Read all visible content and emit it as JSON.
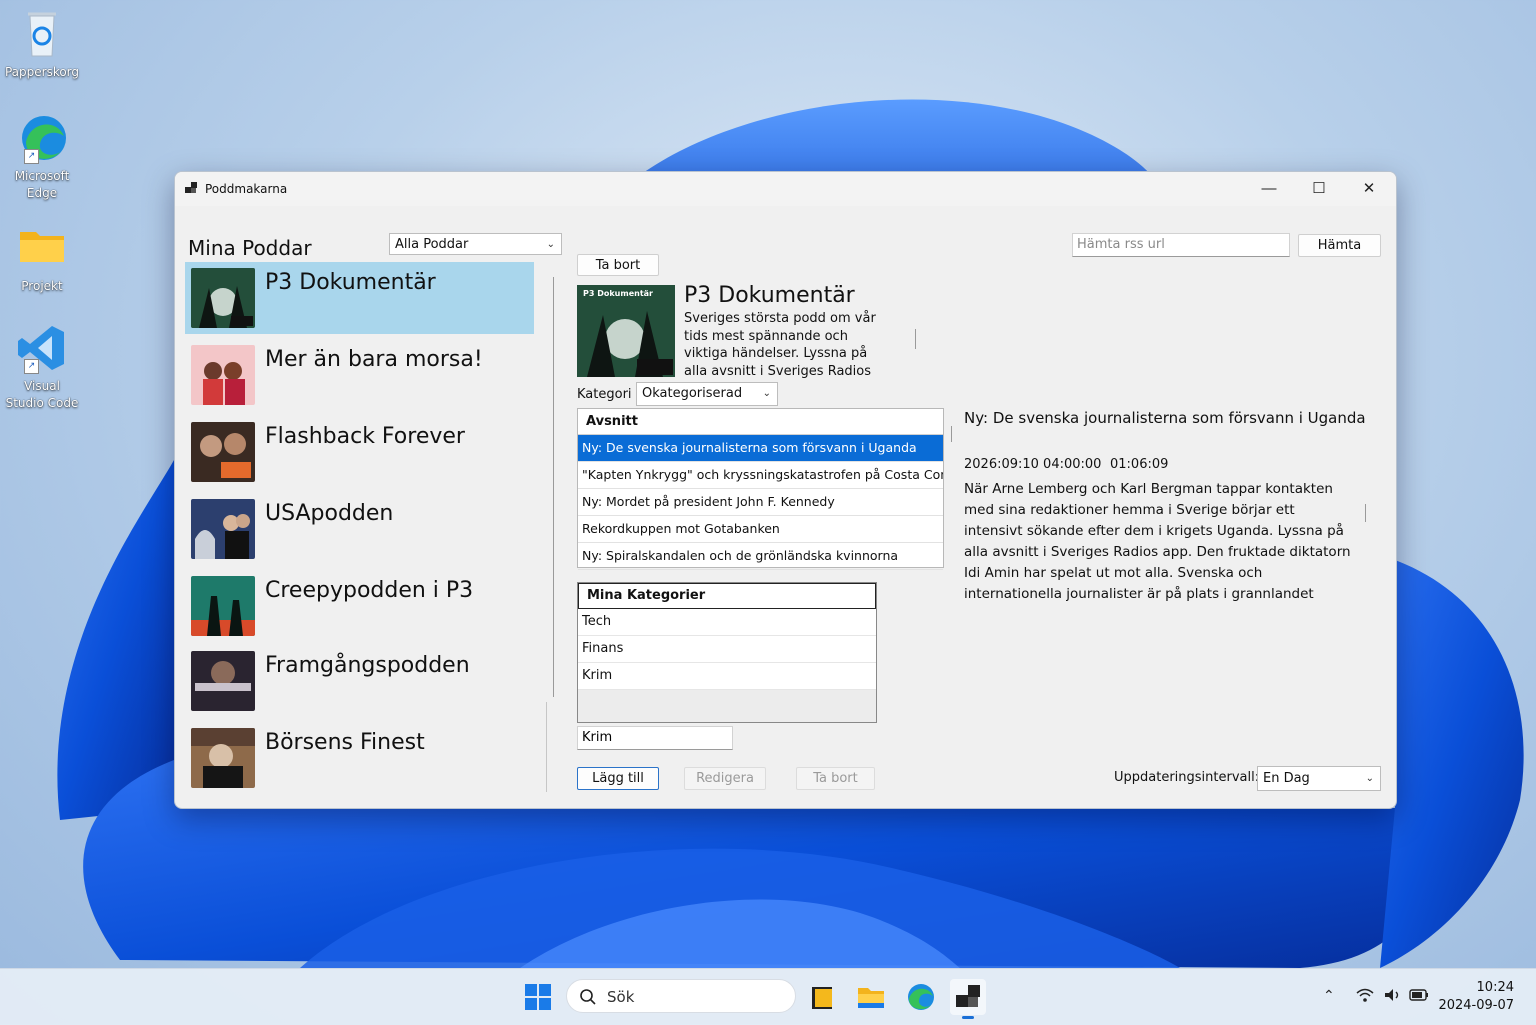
{
  "desktop": {
    "icons": [
      {
        "label": "Papperskorg"
      },
      {
        "label": "Microsoft Edge"
      },
      {
        "label": "Projekt"
      },
      {
        "label": "Visual Studio Code"
      }
    ]
  },
  "window": {
    "title": "Poddmakarna",
    "controls": {
      "minimize": "—",
      "maximize": "☐",
      "close": "✕"
    }
  },
  "left": {
    "heading": "Mina Poddar",
    "filter_value": "Alla Poddar",
    "podcasts": [
      {
        "name": "P3 Dokumentär"
      },
      {
        "name": "Mer än bara morsa!"
      },
      {
        "name": "Flashback Forever"
      },
      {
        "name": "USApodden"
      },
      {
        "name": "Creepypodden i P3"
      },
      {
        "name": "Framgångspodden"
      },
      {
        "name": "Börsens Finest"
      }
    ]
  },
  "toolbar": {
    "rss_placeholder": "Hämta rss url",
    "fetch_label": "Hämta",
    "remove_label": "Ta bort"
  },
  "detail": {
    "title": "P3 Dokumentär",
    "description": "Sveriges största podd om vår tids mest spännande och viktiga händelser. Lyssna på alla avsnitt i Sveriges Radios app.",
    "thumb_caption": "P3 Dokumentär",
    "category_label": "Kategori",
    "category_value": "Okategoriserad"
  },
  "episodes": {
    "header": "Avsnitt",
    "items": [
      "Ny: De svenska journalisterna som försvann i Uganda",
      "\"Kapten Ynkrygg\" och kryssningskatastrofen på Costa Concordia",
      "Ny: Mordet på president John F. Kennedy",
      "Rekordkuppen mot Gotabanken",
      "Ny: Spiralskandalen och de grönländska kvinnorna"
    ]
  },
  "episode_detail": {
    "title": "Ny: De svenska journalisterna som försvann i Uganda",
    "date": "2026:09:10 04:00:00",
    "duration": "01:06:09",
    "description": "När Arne Lemberg och Karl Bergman tappar kontakten med sina redaktioner hemma i Sverige börjar ett intensivt sökande efter dem i krigets Uganda. Lyssna på alla avsnitt i Sveriges Radios app. Den fruktade diktatorn Idi Amin har spelat ut mot alla. Svenska och internationella journalister är på plats i grannlandet Kenya för att följa regimens sista veckor.Svenska"
  },
  "categories": {
    "header": "Mina Kategorier",
    "items": [
      "Tech",
      "Finans",
      "Krim"
    ],
    "input_value": "Krim",
    "add_label": "Lägg till",
    "edit_label": "Redigera",
    "remove_label": "Ta bort"
  },
  "update": {
    "label": "Uppdateringsintervall:",
    "value": "En Dag"
  },
  "taskbar": {
    "search_text": "Sök",
    "time": "10:24",
    "date": "2024-09-07"
  },
  "colors": {
    "selection_list": "#a9d6ec",
    "selection_grid": "#0a6cd6",
    "accent": "#2b73c9"
  }
}
